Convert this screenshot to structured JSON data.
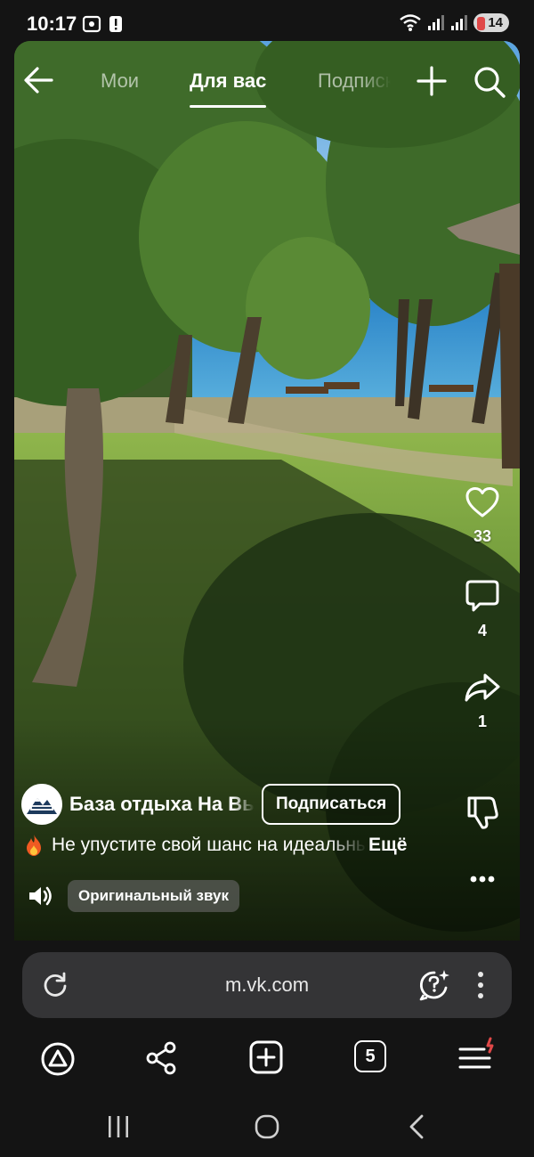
{
  "status_bar": {
    "time": "10:17",
    "battery": "14"
  },
  "top_nav": {
    "tabs": [
      {
        "label": "Мои"
      },
      {
        "label": "Для вас"
      },
      {
        "label": "Подписки"
      }
    ],
    "icons": [
      "arrow-left-icon",
      "plus-icon",
      "search-icon"
    ]
  },
  "actions": {
    "likes": "33",
    "comments": "4",
    "shares": "1"
  },
  "author": {
    "name": "База отдыха На Высоте",
    "subscribe_label": "Подписаться"
  },
  "caption": {
    "text": "Не упустите свой шанс на идеальный отдых",
    "more_label": "Ещё"
  },
  "sound": {
    "label": "Оригинальный звук"
  },
  "browser": {
    "url": "m.vk.com",
    "tabs_count": "5"
  },
  "colors": {
    "background": "#141414",
    "url_bar": "#343436",
    "accent_red": "#e04848"
  }
}
